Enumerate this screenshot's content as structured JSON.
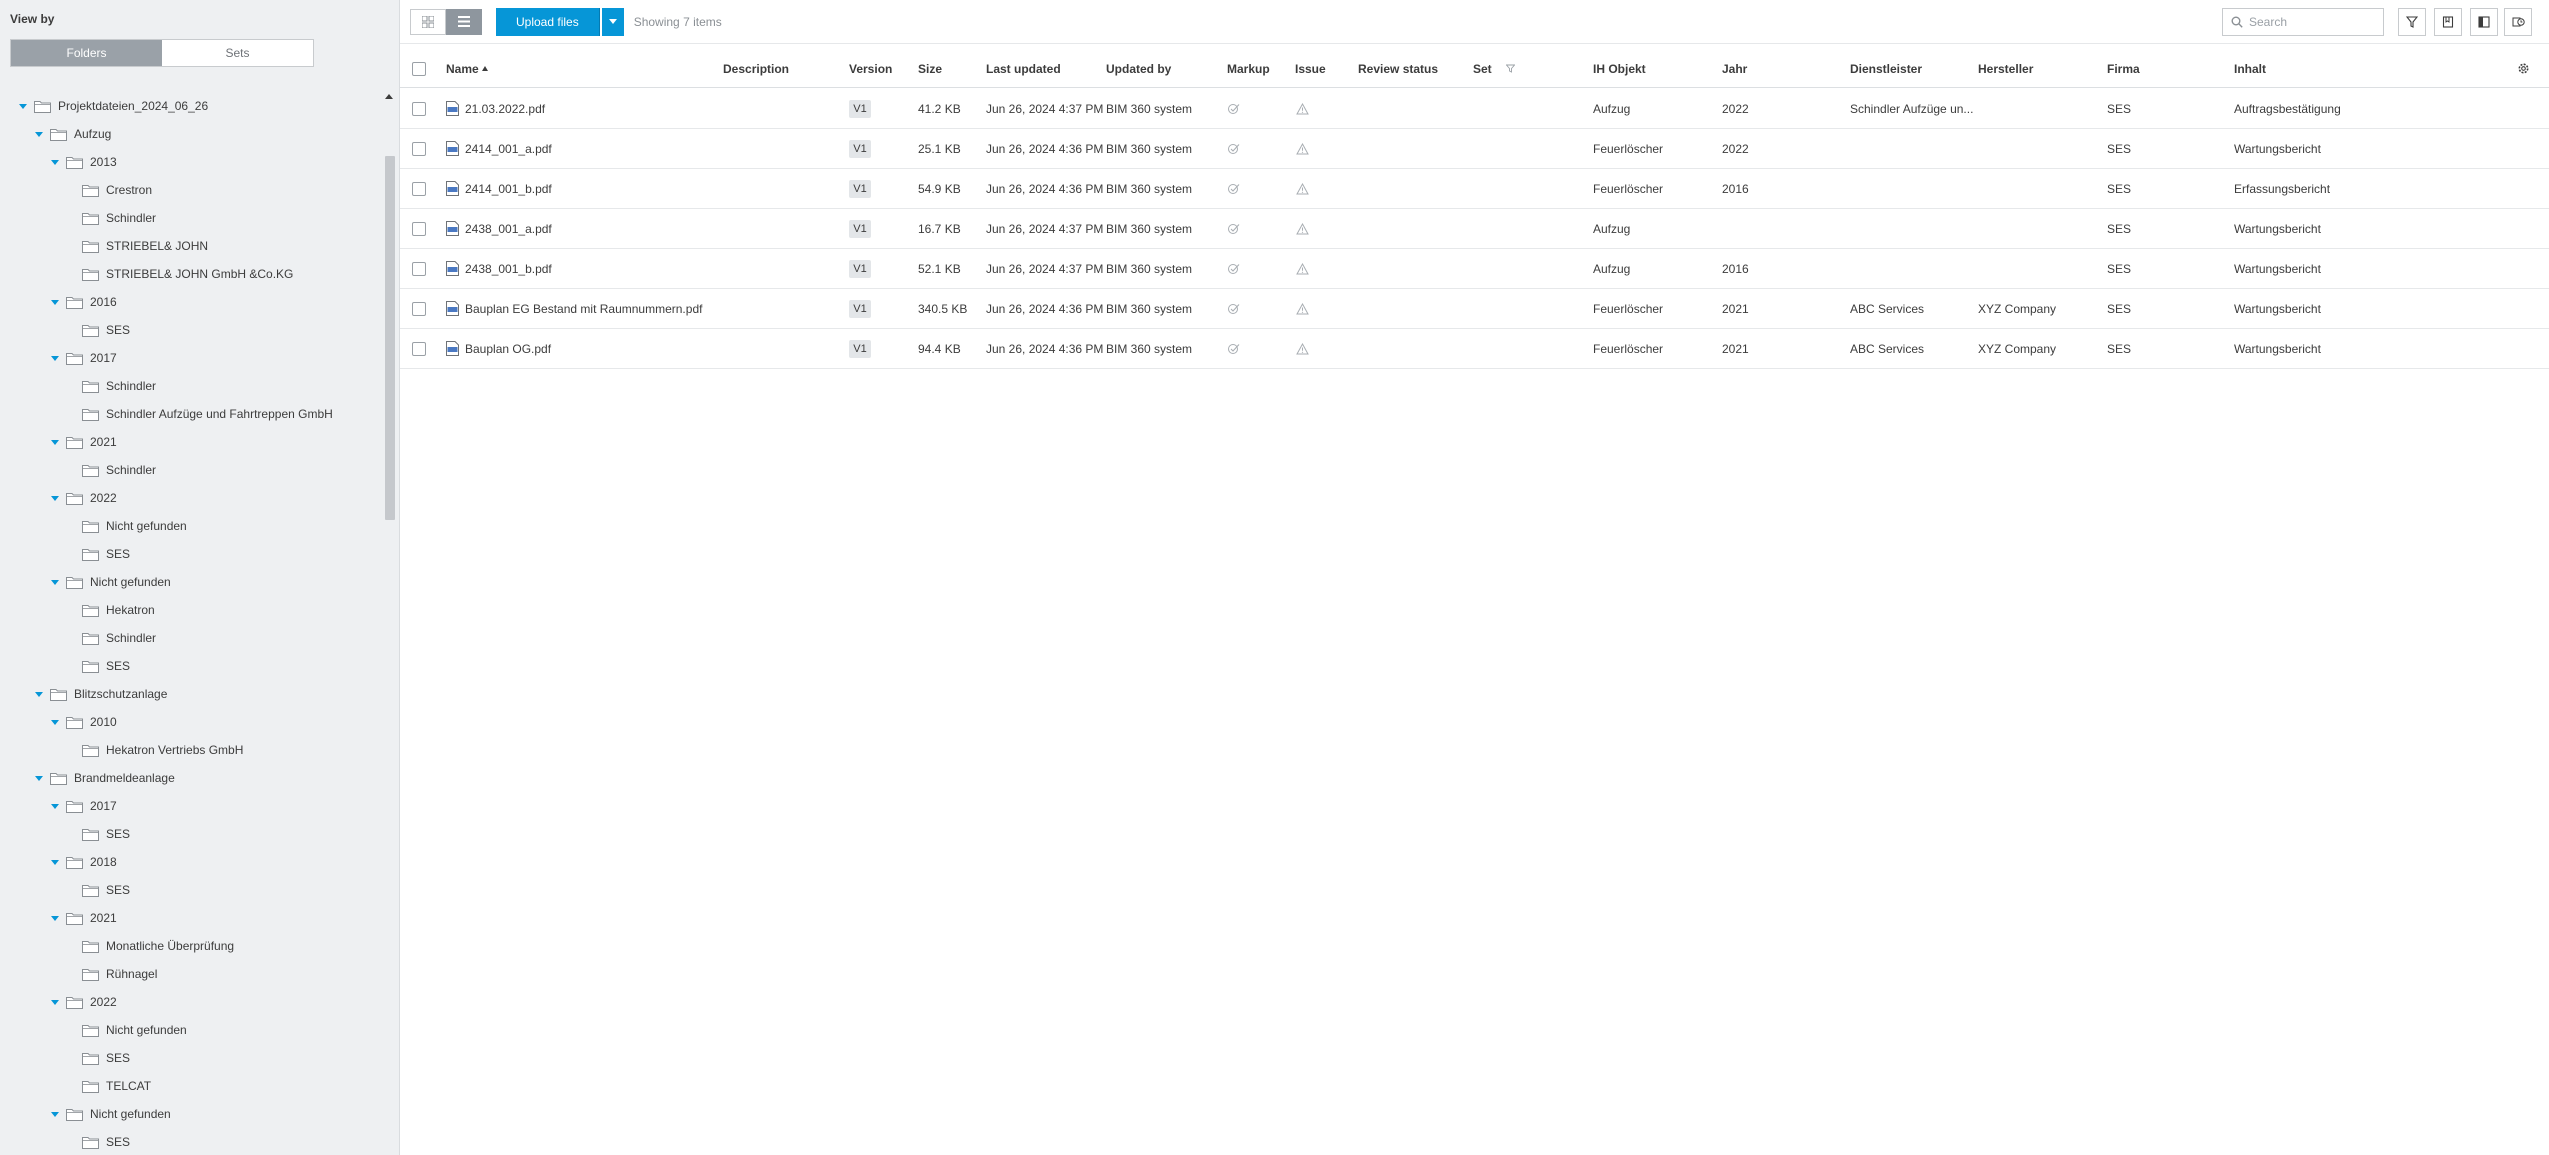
{
  "sidebar": {
    "view_by_label": "View by",
    "toggle": {
      "folders": "Folders",
      "sets": "Sets"
    },
    "tree": [
      {
        "label": "Projektdateien_2024_06_26",
        "level": 0,
        "expanded": true
      },
      {
        "label": "Aufzug",
        "level": 1,
        "expanded": true
      },
      {
        "label": "2013",
        "level": 2,
        "expanded": true
      },
      {
        "label": "Crestron",
        "level": 3,
        "expanded": false
      },
      {
        "label": "Schindler",
        "level": 3,
        "expanded": false
      },
      {
        "label": "STRIEBEL& JOHN",
        "level": 3,
        "expanded": false
      },
      {
        "label": "STRIEBEL& JOHN GmbH &Co.KG",
        "level": 3,
        "expanded": false
      },
      {
        "label": "2016",
        "level": 2,
        "expanded": true
      },
      {
        "label": "SES",
        "level": 3,
        "expanded": false
      },
      {
        "label": "2017",
        "level": 2,
        "expanded": true
      },
      {
        "label": "Schindler",
        "level": 3,
        "expanded": false
      },
      {
        "label": "Schindler Aufzüge und Fahrtreppen GmbH",
        "level": 3,
        "expanded": false
      },
      {
        "label": "2021",
        "level": 2,
        "expanded": true
      },
      {
        "label": "Schindler",
        "level": 3,
        "expanded": false
      },
      {
        "label": "2022",
        "level": 2,
        "expanded": true
      },
      {
        "label": "Nicht gefunden",
        "level": 3,
        "expanded": false
      },
      {
        "label": "SES",
        "level": 3,
        "expanded": false
      },
      {
        "label": "Nicht gefunden",
        "level": 2,
        "expanded": true
      },
      {
        "label": "Hekatron",
        "level": 3,
        "expanded": false
      },
      {
        "label": "Schindler",
        "level": 3,
        "expanded": false
      },
      {
        "label": "SES",
        "level": 3,
        "expanded": false
      },
      {
        "label": "Blitzschutzanlage",
        "level": 1,
        "expanded": true
      },
      {
        "label": "2010",
        "level": 2,
        "expanded": true
      },
      {
        "label": "Hekatron Vertriebs GmbH",
        "level": 3,
        "expanded": false
      },
      {
        "label": "Brandmeldeanlage",
        "level": 1,
        "expanded": true
      },
      {
        "label": "2017",
        "level": 2,
        "expanded": true
      },
      {
        "label": "SES",
        "level": 3,
        "expanded": false
      },
      {
        "label": "2018",
        "level": 2,
        "expanded": true
      },
      {
        "label": "SES",
        "level": 3,
        "expanded": false
      },
      {
        "label": "2021",
        "level": 2,
        "expanded": true
      },
      {
        "label": "Monatliche Überprüfung",
        "level": 3,
        "expanded": false
      },
      {
        "label": "Rühnagel",
        "level": 3,
        "expanded": false
      },
      {
        "label": "2022",
        "level": 2,
        "expanded": true
      },
      {
        "label": "Nicht gefunden",
        "level": 3,
        "expanded": false
      },
      {
        "label": "SES",
        "level": 3,
        "expanded": false
      },
      {
        "label": "TELCAT",
        "level": 3,
        "expanded": false
      },
      {
        "label": "Nicht gefunden",
        "level": 2,
        "expanded": true
      },
      {
        "label": "SES",
        "level": 3,
        "expanded": false
      }
    ]
  },
  "toolbar": {
    "upload_label": "Upload files",
    "showing": "Showing 7 items",
    "search_placeholder": "Search"
  },
  "table": {
    "columns": {
      "name": "Name",
      "description": "Description",
      "version": "Version",
      "size": "Size",
      "last_updated": "Last updated",
      "updated_by": "Updated by",
      "markup": "Markup",
      "issue": "Issue",
      "review_status": "Review status",
      "set": "Set",
      "ih_objekt": "IH Objekt",
      "jahr": "Jahr",
      "dienstleister": "Dienstleister",
      "hersteller": "Hersteller",
      "firma": "Firma",
      "inhalt": "Inhalt"
    },
    "rows": [
      {
        "name": "21.03.2022.pdf",
        "description": "",
        "version": "V1",
        "size": "41.2 KB",
        "last_updated": "Jun 26, 2024 4:37 PM",
        "updated_by": "BIM 360 system",
        "ih_objekt": "Aufzug",
        "jahr": "2022",
        "dienstleister": "Schindler Aufzüge un...",
        "hersteller": "",
        "firma": "SES",
        "inhalt": "Auftragsbestätigung"
      },
      {
        "name": "2414_001_a.pdf",
        "description": "",
        "version": "V1",
        "size": "25.1 KB",
        "last_updated": "Jun 26, 2024 4:36 PM",
        "updated_by": "BIM 360 system",
        "ih_objekt": "Feuerlöscher",
        "jahr": "2022",
        "dienstleister": "",
        "hersteller": "",
        "firma": "SES",
        "inhalt": "Wartungsbericht"
      },
      {
        "name": "2414_001_b.pdf",
        "description": "",
        "version": "V1",
        "size": "54.9 KB",
        "last_updated": "Jun 26, 2024 4:36 PM",
        "updated_by": "BIM 360 system",
        "ih_objekt": "Feuerlöscher",
        "jahr": "2016",
        "dienstleister": "",
        "hersteller": "",
        "firma": "SES",
        "inhalt": "Erfassungsbericht"
      },
      {
        "name": "2438_001_a.pdf",
        "description": "",
        "version": "V1",
        "size": "16.7 KB",
        "last_updated": "Jun 26, 2024 4:37 PM",
        "updated_by": "BIM 360 system",
        "ih_objekt": "Aufzug",
        "jahr": "",
        "dienstleister": "",
        "hersteller": "",
        "firma": "SES",
        "inhalt": "Wartungsbericht"
      },
      {
        "name": "2438_001_b.pdf",
        "description": "",
        "version": "V1",
        "size": "52.1 KB",
        "last_updated": "Jun 26, 2024 4:37 PM",
        "updated_by": "BIM 360 system",
        "ih_objekt": "Aufzug",
        "jahr": "2016",
        "dienstleister": "",
        "hersteller": "",
        "firma": "SES",
        "inhalt": "Wartungsbericht"
      },
      {
        "name": "Bauplan EG Bestand mit Raumnummern.pdf",
        "description": "",
        "version": "V1",
        "size": "340.5 KB",
        "last_updated": "Jun 26, 2024 4:36 PM",
        "updated_by": "BIM 360 system",
        "ih_objekt": "Feuerlöscher",
        "jahr": "2021",
        "dienstleister": "ABC Services",
        "hersteller": "XYZ Company",
        "firma": "SES",
        "inhalt": "Wartungsbericht"
      },
      {
        "name": "Bauplan OG.pdf",
        "description": "",
        "version": "V1",
        "size": "94.4 KB",
        "last_updated": "Jun 26, 2024 4:36 PM",
        "updated_by": "BIM 360 system",
        "ih_objekt": "Feuerlöscher",
        "jahr": "2021",
        "dienstleister": "ABC Services",
        "hersteller": "XYZ Company",
        "firma": "SES",
        "inhalt": "Wartungsbericht"
      }
    ]
  },
  "icons": {
    "folder": "folder-icon",
    "pdf": "pdf-file-icon",
    "markup": "markup-check-icon",
    "issue": "warning-triangle-icon",
    "search": "search-icon",
    "filter": "filter-icon",
    "settings": "gear-icon"
  },
  "colors": {
    "accent": "#0696d7",
    "sidebar_bg": "#eef0f2",
    "toggle_active": "#9aa1a8"
  }
}
